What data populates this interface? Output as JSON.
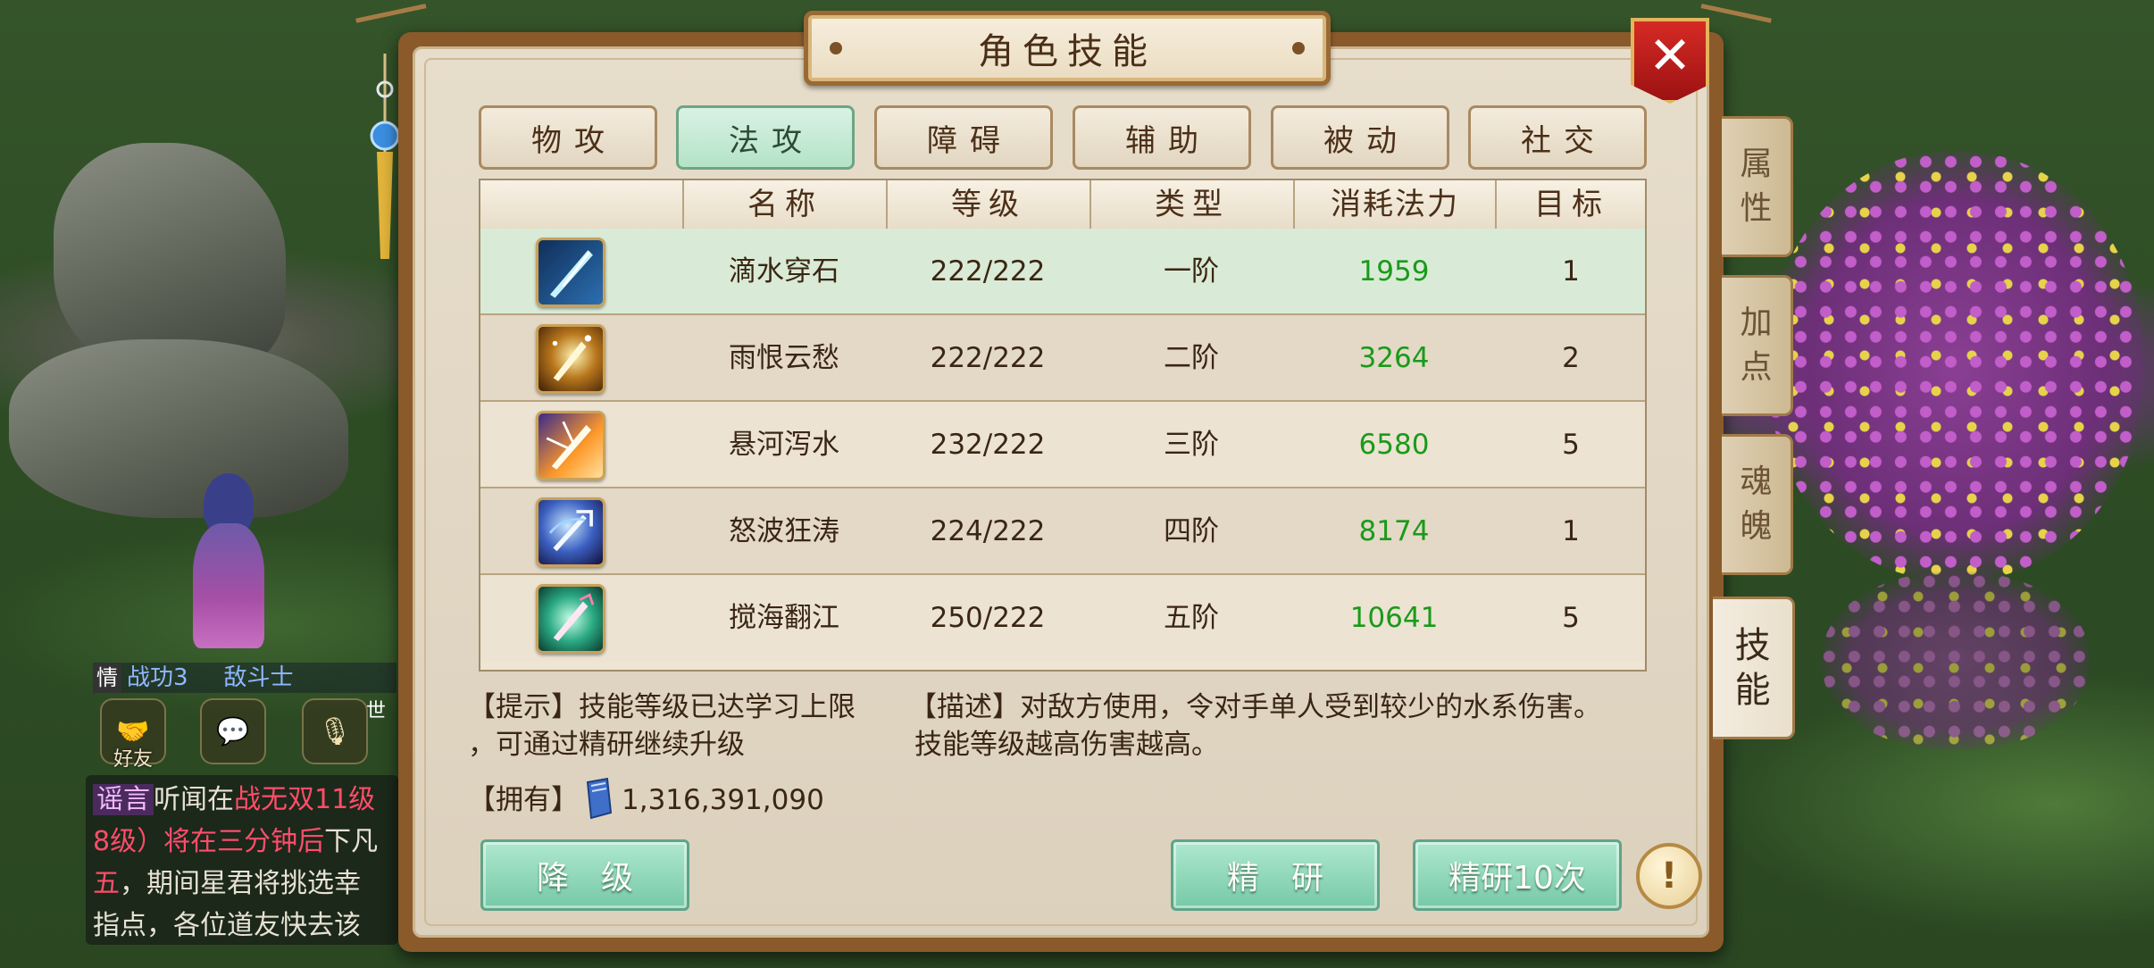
{
  "window": {
    "title": "角色技能",
    "close_label": "✕"
  },
  "categories": [
    {
      "label": "物攻",
      "active": false
    },
    {
      "label": "法攻",
      "active": true
    },
    {
      "label": "障碍",
      "active": false
    },
    {
      "label": "辅助",
      "active": false
    },
    {
      "label": "被动",
      "active": false
    },
    {
      "label": "社交",
      "active": false
    }
  ],
  "table": {
    "headers": [
      "",
      "名称",
      "等级",
      "类型",
      "消耗法力",
      "目标"
    ],
    "rows": [
      {
        "icon": "water-blade-icon",
        "name": "滴水穿石",
        "level": "222/222",
        "type": "一阶",
        "mana": "1959",
        "target": "1",
        "selected": true
      },
      {
        "icon": "golden-sword-icon",
        "name": "雨恨云愁",
        "level": "222/222",
        "type": "二阶",
        "mana": "3264",
        "target": "2",
        "selected": false
      },
      {
        "icon": "radiant-sword-icon",
        "name": "悬河泻水",
        "level": "232/222",
        "type": "三阶",
        "mana": "6580",
        "target": "5",
        "selected": false
      },
      {
        "icon": "trident-icon",
        "name": "怒波狂涛",
        "level": "224/222",
        "type": "四阶",
        "mana": "8174",
        "target": "1",
        "selected": false
      },
      {
        "icon": "jade-sword-icon",
        "name": "搅海翻江",
        "level": "250/222",
        "type": "五阶",
        "mana": "10641",
        "target": "5",
        "selected": false
      }
    ]
  },
  "hint": {
    "line1": "【提示】技能等级已达学习上限",
    "line2": "，可通过精研继续升级"
  },
  "description": {
    "line1": "【描述】对敌方使用，令对手单人受到较少的水系伤害。",
    "line2": "技能等级越高伤害越高。"
  },
  "owned": {
    "label": "【拥有】",
    "value": "1,316,391,090"
  },
  "buttons": {
    "downgrade": "降　级",
    "study": "精　研",
    "study10": "精研10次",
    "help": "!"
  },
  "side_tabs": [
    {
      "label": "属\n性",
      "active": false
    },
    {
      "label": "加\n点",
      "active": false
    },
    {
      "label": "魂\n魄",
      "active": false
    },
    {
      "label": "技\n能",
      "active": true
    }
  ],
  "hud": {
    "battle_line_tag": "情",
    "battle_line": "战功3",
    "battle_line_rest": "敌斗士",
    "friends_label": "好友",
    "world_label": "世"
  },
  "chat": {
    "tag": "谣言",
    "line1_a": "听闻在",
    "line1_b": "战无双11级",
    "line2_a": "8级）将在",
    "line2_b": "三分钟后",
    "line2_c": "下凡",
    "line3_a": "五",
    "line3_b": "，期间星君将挑选幸",
    "line4": "指点，各位道友快去该"
  },
  "colors": {
    "mana_green": "#1a9a1a",
    "button_green": "#76c9a6",
    "close_red": "#c51f1b",
    "panel_border": "#8a5a2b"
  }
}
